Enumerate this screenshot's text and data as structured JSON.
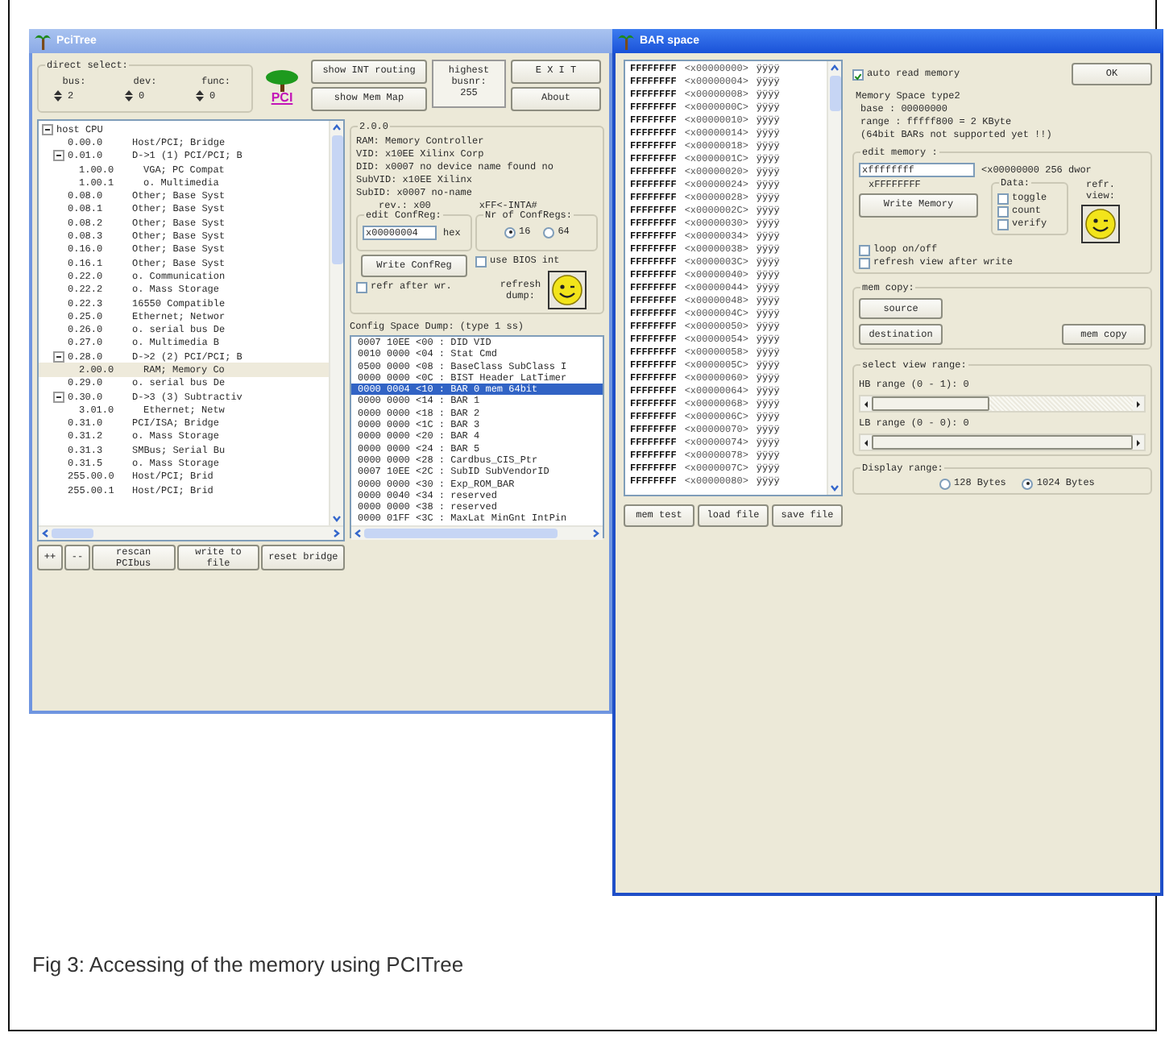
{
  "pcitree_window": {
    "title": "PciTree",
    "direct_select": {
      "title": "direct select:",
      "fields": [
        {
          "label": "bus:",
          "value": "2"
        },
        {
          "label": "dev:",
          "value": "0"
        },
        {
          "label": "func:",
          "value": "0"
        }
      ]
    },
    "logo_text": "PCI",
    "buttons": [
      "show INT routing",
      "show Mem Map"
    ],
    "highest_busnr": {
      "label": "highest busnr:",
      "value": "255"
    },
    "exit_button": "E X I T",
    "about_button": "About",
    "tree": [
      {
        "text": "host CPU",
        "expanded": true,
        "selected": false,
        "children": [
          {
            "id": "0.00.0",
            "text": "Host/PCI; Bridge",
            "selected": false
          },
          {
            "id": "0.01.0",
            "text": "D->1 (1)  PCI/PCI; B",
            "expanded": true,
            "selected": false,
            "children": [
              {
                "id": "1.00.0",
                "text": "VGA; PC Compat",
                "selected": false
              },
              {
                "id": "1.00.1",
                "text": "o. Multimedia",
                "selected": false
              }
            ]
          },
          {
            "id": "0.08.0",
            "text": "Other; Base Syst",
            "selected": false
          },
          {
            "id": "0.08.1",
            "text": "Other; Base Syst",
            "selected": false
          },
          {
            "id": "0.08.2",
            "text": "Other; Base Syst",
            "selected": false
          },
          {
            "id": "0.08.3",
            "text": "Other; Base Syst",
            "selected": false
          },
          {
            "id": "0.16.0",
            "text": "Other; Base Syst",
            "selected": false
          },
          {
            "id": "0.16.1",
            "text": "Other; Base Syst",
            "selected": false
          },
          {
            "id": "0.22.0",
            "text": "o. Communication",
            "selected": false
          },
          {
            "id": "0.22.2",
            "text": "o. Mass Storage",
            "selected": false
          },
          {
            "id": "0.22.3",
            "text": "16550 Compatible",
            "selected": false
          },
          {
            "id": "0.25.0",
            "text": "Ethernet; Networ",
            "selected": false
          },
          {
            "id": "0.26.0",
            "text": "o. serial bus De",
            "selected": false
          },
          {
            "id": "0.27.0",
            "text": "o. Multimedia  B",
            "selected": false
          },
          {
            "id": "0.28.0",
            "text": "D->2 (2)  PCI/PCI; B",
            "expanded": true,
            "selected": false,
            "children": [
              {
                "id": "2.00.0",
                "text": "RAM; Memory Co",
                "selected": true
              }
            ]
          },
          {
            "id": "0.29.0",
            "text": "o. serial bus De",
            "selected": false
          },
          {
            "id": "0.30.0",
            "text": "D->3 (3)  Subtractiv",
            "expanded": true,
            "selected": false,
            "children": [
              {
                "id": "3.01.0",
                "text": "Ethernet; Netw",
                "selected": false
              }
            ]
          },
          {
            "id": "0.31.0",
            "text": "PCI/ISA; Bridge",
            "selected": false
          },
          {
            "id": "0.31.2",
            "text": "o. Mass Storage",
            "selected": false
          },
          {
            "id": "0.31.3",
            "text": "SMBus; Serial Bu",
            "selected": false
          },
          {
            "id": "0.31.5",
            "text": "o. Mass Storage",
            "selected": false
          },
          {
            "id": "255.00.0",
            "text": "Host/PCI; Brid",
            "selected": false
          },
          {
            "id": "255.00.1",
            "text": "Host/PCI; Brid",
            "selected": false
          }
        ]
      }
    ],
    "bottom_buttons": [
      "++",
      "--",
      "rescan PCIbus",
      "write to file",
      "reset bridge"
    ],
    "device": {
      "title": "2.0.0",
      "lines": [
        "RAM: Memory Controller",
        "VID: x10EE Xilinx Corp",
        "DID: x0007 no device name found no",
        "SubVID: x10EE Xilinx",
        "SubID: x0007 no-name"
      ],
      "rev": "rev.: x00",
      "int": "xFF<-INTA#"
    },
    "edit_confreg": {
      "title": "edit ConfReg:",
      "value": "x00000004",
      "unit": "hex"
    },
    "nr_confregs": {
      "title": "Nr of ConfRegs:",
      "options": [
        {
          "label": "16",
          "selected": true
        },
        {
          "label": "64",
          "selected": false
        }
      ]
    },
    "use_bios": {
      "label": "use BIOS int",
      "checked": false
    },
    "write_button": "Write ConfReg",
    "refr_after": {
      "label": "refr after wr.",
      "checked": false
    },
    "refresh_label": "refresh dump:",
    "dump_title": "Config Space Dump: (type 1 ss)",
    "dump_rows": [
      {
        "text": "0007 10EE <00 : DID VID",
        "selected": false
      },
      {
        "text": "0010 0000 <04 : Stat Cmd",
        "selected": false
      },
      {
        "text": "0500 0000 <08 : BaseClass SubClass I",
        "selected": false
      },
      {
        "text": "0000 0000 <0C : BIST Header LatTimer",
        "selected": false
      },
      {
        "text": "0000 0004 <10 : BAR 0 mem 64bit",
        "selected": true
      },
      {
        "text": "0000 0000 <14 : BAR 1",
        "selected": false
      },
      {
        "text": "0000 0000 <18 : BAR 2",
        "selected": false
      },
      {
        "text": "0000 0000 <1C : BAR 3",
        "selected": false
      },
      {
        "text": "0000 0000 <20 : BAR 4",
        "selected": false
      },
      {
        "text": "0000 0000 <24 : BAR 5",
        "selected": false
      },
      {
        "text": "0000 0000 <28 : Cardbus_CIS_Ptr",
        "selected": false
      },
      {
        "text": "0007 10EE <2C : SubID SubVendorID",
        "selected": false
      },
      {
        "text": "0000 0000 <30 : Exp_ROM_BAR",
        "selected": false
      },
      {
        "text": "0000 0040 <34 : reserved",
        "selected": false
      },
      {
        "text": "0000 0000 <38 : reserved",
        "selected": false
      },
      {
        "text": "0000 01FF <3C : MaxLat MinGnt IntPin",
        "selected": false
      }
    ]
  },
  "bar_window": {
    "title": "BAR space",
    "rows": [
      {
        "value": "FFFFFFFF",
        "address": "<x00000000>",
        "ascii": "ÿÿÿÿ"
      },
      {
        "value": "FFFFFFFF",
        "address": "<x00000004>",
        "ascii": "ÿÿÿÿ"
      },
      {
        "value": "FFFFFFFF",
        "address": "<x00000008>",
        "ascii": "ÿÿÿÿ"
      },
      {
        "value": "FFFFFFFF",
        "address": "<x0000000C>",
        "ascii": "ÿÿÿÿ"
      },
      {
        "value": "FFFFFFFF",
        "address": "<x00000010>",
        "ascii": "ÿÿÿÿ"
      },
      {
        "value": "FFFFFFFF",
        "address": "<x00000014>",
        "ascii": "ÿÿÿÿ"
      },
      {
        "value": "FFFFFFFF",
        "address": "<x00000018>",
        "ascii": "ÿÿÿÿ"
      },
      {
        "value": "FFFFFFFF",
        "address": "<x0000001C>",
        "ascii": "ÿÿÿÿ"
      },
      {
        "value": "FFFFFFFF",
        "address": "<x00000020>",
        "ascii": "ÿÿÿÿ"
      },
      {
        "value": "FFFFFFFF",
        "address": "<x00000024>",
        "ascii": "ÿÿÿÿ"
      },
      {
        "value": "FFFFFFFF",
        "address": "<x00000028>",
        "ascii": "ÿÿÿÿ"
      },
      {
        "value": "FFFFFFFF",
        "address": "<x0000002C>",
        "ascii": "ÿÿÿÿ"
      },
      {
        "value": "FFFFFFFF",
        "address": "<x00000030>",
        "ascii": "ÿÿÿÿ"
      },
      {
        "value": "FFFFFFFF",
        "address": "<x00000034>",
        "ascii": "ÿÿÿÿ"
      },
      {
        "value": "FFFFFFFF",
        "address": "<x00000038>",
        "ascii": "ÿÿÿÿ"
      },
      {
        "value": "FFFFFFFF",
        "address": "<x0000003C>",
        "ascii": "ÿÿÿÿ"
      },
      {
        "value": "FFFFFFFF",
        "address": "<x00000040>",
        "ascii": "ÿÿÿÿ"
      },
      {
        "value": "FFFFFFFF",
        "address": "<x00000044>",
        "ascii": "ÿÿÿÿ"
      },
      {
        "value": "FFFFFFFF",
        "address": "<x00000048>",
        "ascii": "ÿÿÿÿ"
      },
      {
        "value": "FFFFFFFF",
        "address": "<x0000004C>",
        "ascii": "ÿÿÿÿ"
      },
      {
        "value": "FFFFFFFF",
        "address": "<x00000050>",
        "ascii": "ÿÿÿÿ"
      },
      {
        "value": "FFFFFFFF",
        "address": "<x00000054>",
        "ascii": "ÿÿÿÿ"
      },
      {
        "value": "FFFFFFFF",
        "address": "<x00000058>",
        "ascii": "ÿÿÿÿ"
      },
      {
        "value": "FFFFFFFF",
        "address": "<x0000005C>",
        "ascii": "ÿÿÿÿ"
      },
      {
        "value": "FFFFFFFF",
        "address": "<x00000060>",
        "ascii": "ÿÿÿÿ"
      },
      {
        "value": "FFFFFFFF",
        "address": "<x00000064>",
        "ascii": "ÿÿÿÿ"
      },
      {
        "value": "FFFFFFFF",
        "address": "<x00000068>",
        "ascii": "ÿÿÿÿ"
      },
      {
        "value": "FFFFFFFF",
        "address": "<x0000006C>",
        "ascii": "ÿÿÿÿ"
      },
      {
        "value": "FFFFFFFF",
        "address": "<x00000070>",
        "ascii": "ÿÿÿÿ"
      },
      {
        "value": "FFFFFFFF",
        "address": "<x00000074>",
        "ascii": "ÿÿÿÿ"
      },
      {
        "value": "FFFFFFFF",
        "address": "<x00000078>",
        "ascii": "ÿÿÿÿ"
      },
      {
        "value": "FFFFFFFF",
        "address": "<x0000007C>",
        "ascii": "ÿÿÿÿ"
      },
      {
        "value": "FFFFFFFF",
        "address": "<x00000080>",
        "ascii": "ÿÿÿÿ"
      }
    ],
    "buttons": [
      "mem test",
      "load file",
      "save file"
    ],
    "auto_read": {
      "label": "auto read memory",
      "checked": true
    },
    "ok_button": "OK",
    "info_lines": [
      "Memory Space type2",
      "base : 00000000",
      "range : fffff800 = 2 KByte",
      "(64bit BARs not supported yet !!)"
    ],
    "edit_memory": {
      "title": "edit memory :",
      "value": "xffffffff",
      "readback": "xFFFFFFFF",
      "address": "<x00000000 256 dwor",
      "write_button": "Write Memory",
      "data": {
        "title": "Data:",
        "options": [
          {
            "label": "toggle",
            "checked": false
          },
          {
            "label": "count",
            "checked": false
          },
          {
            "label": "verify",
            "checked": false
          }
        ]
      },
      "refr_label": "refr. view:",
      "loop": {
        "label": "loop on/off",
        "checked": false
      },
      "refresh_after": {
        "label": "refresh view after write",
        "checked": false
      }
    },
    "mem_copy": {
      "title": "mem copy:",
      "buttons": [
        "source",
        "destination",
        "mem copy"
      ]
    },
    "view_range": {
      "title": "select view range:",
      "sliders": [
        {
          "label": "HB range (0 - 1): 0",
          "level": 0.45
        },
        {
          "label": "LB range (0 - 0): 0",
          "level": 1
        }
      ]
    },
    "display_range": {
      "title": "Display range:",
      "options": [
        {
          "label": "128 Bytes",
          "selected": false
        },
        {
          "label": "1024 Bytes",
          "selected": true
        }
      ]
    }
  },
  "caption": "Fig 3: Accessing of the memory using PCITree"
}
